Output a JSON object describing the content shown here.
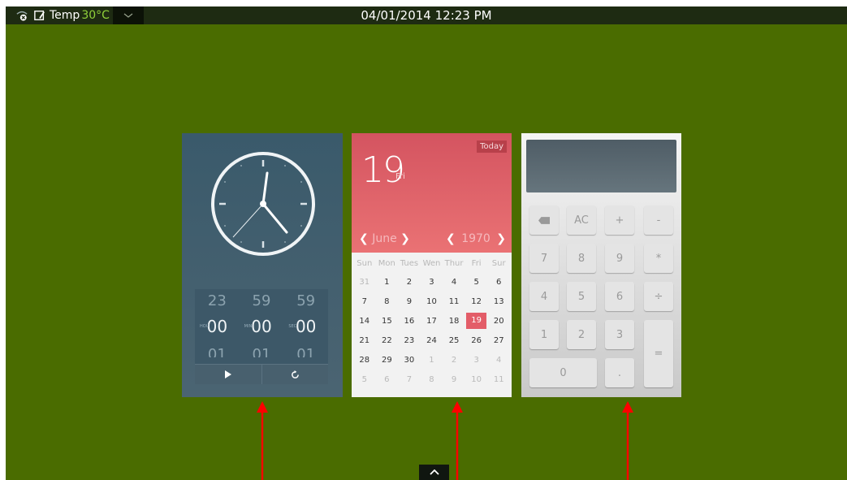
{
  "status_bar": {
    "temp_label": "Temp",
    "temp_value": "30°C",
    "datetime": "04/01/2014 12:23 PM",
    "icons": [
      "settings-wifi-icon",
      "tablet-edit-icon"
    ]
  },
  "clock_widget": {
    "timer": {
      "prev_row": [
        "23",
        "59",
        "59"
      ],
      "current_labels": [
        "HOU",
        "MIN",
        "SEC"
      ],
      "current_values": [
        "00",
        "00",
        "00"
      ],
      "next_row": [
        "01",
        "01",
        "01"
      ]
    },
    "controls": [
      "play-icon",
      "reset-icon"
    ]
  },
  "calendar_widget": {
    "today_label": "Today",
    "day": "19",
    "weekday": "Fri",
    "month": "June",
    "year": "1970",
    "weekday_headers": [
      "Sun",
      "Mon",
      "Tues",
      "Wen",
      "Thur",
      "Fri",
      "Sur"
    ],
    "weeks": [
      [
        "31",
        "1",
        "2",
        "3",
        "4",
        "5",
        "6"
      ],
      [
        "7",
        "8",
        "9",
        "10",
        "11",
        "12",
        "13"
      ],
      [
        "14",
        "15",
        "16",
        "17",
        "18",
        "19",
        "20"
      ],
      [
        "21",
        "22",
        "23",
        "24",
        "25",
        "26",
        "27"
      ],
      [
        "28",
        "29",
        "30",
        "1",
        "2",
        "3",
        "4"
      ],
      [
        "5",
        "6",
        "7",
        "8",
        "9",
        "10",
        "11"
      ]
    ],
    "selected_day": "19"
  },
  "calculator_widget": {
    "display": "",
    "keys": {
      "backspace": "⌫",
      "ac": "AC",
      "plus": "+",
      "minus": "-",
      "seven": "7",
      "eight": "8",
      "nine": "9",
      "multiply": "*",
      "four": "4",
      "five": "5",
      "six": "6",
      "divide": "÷",
      "one": "1",
      "two": "2",
      "three": "3",
      "equals": "=",
      "zero": "0",
      "dot": "."
    }
  },
  "colors": {
    "background": "#4a6c00",
    "accent_red": "#e35d68",
    "arrow": "#ff0000"
  }
}
